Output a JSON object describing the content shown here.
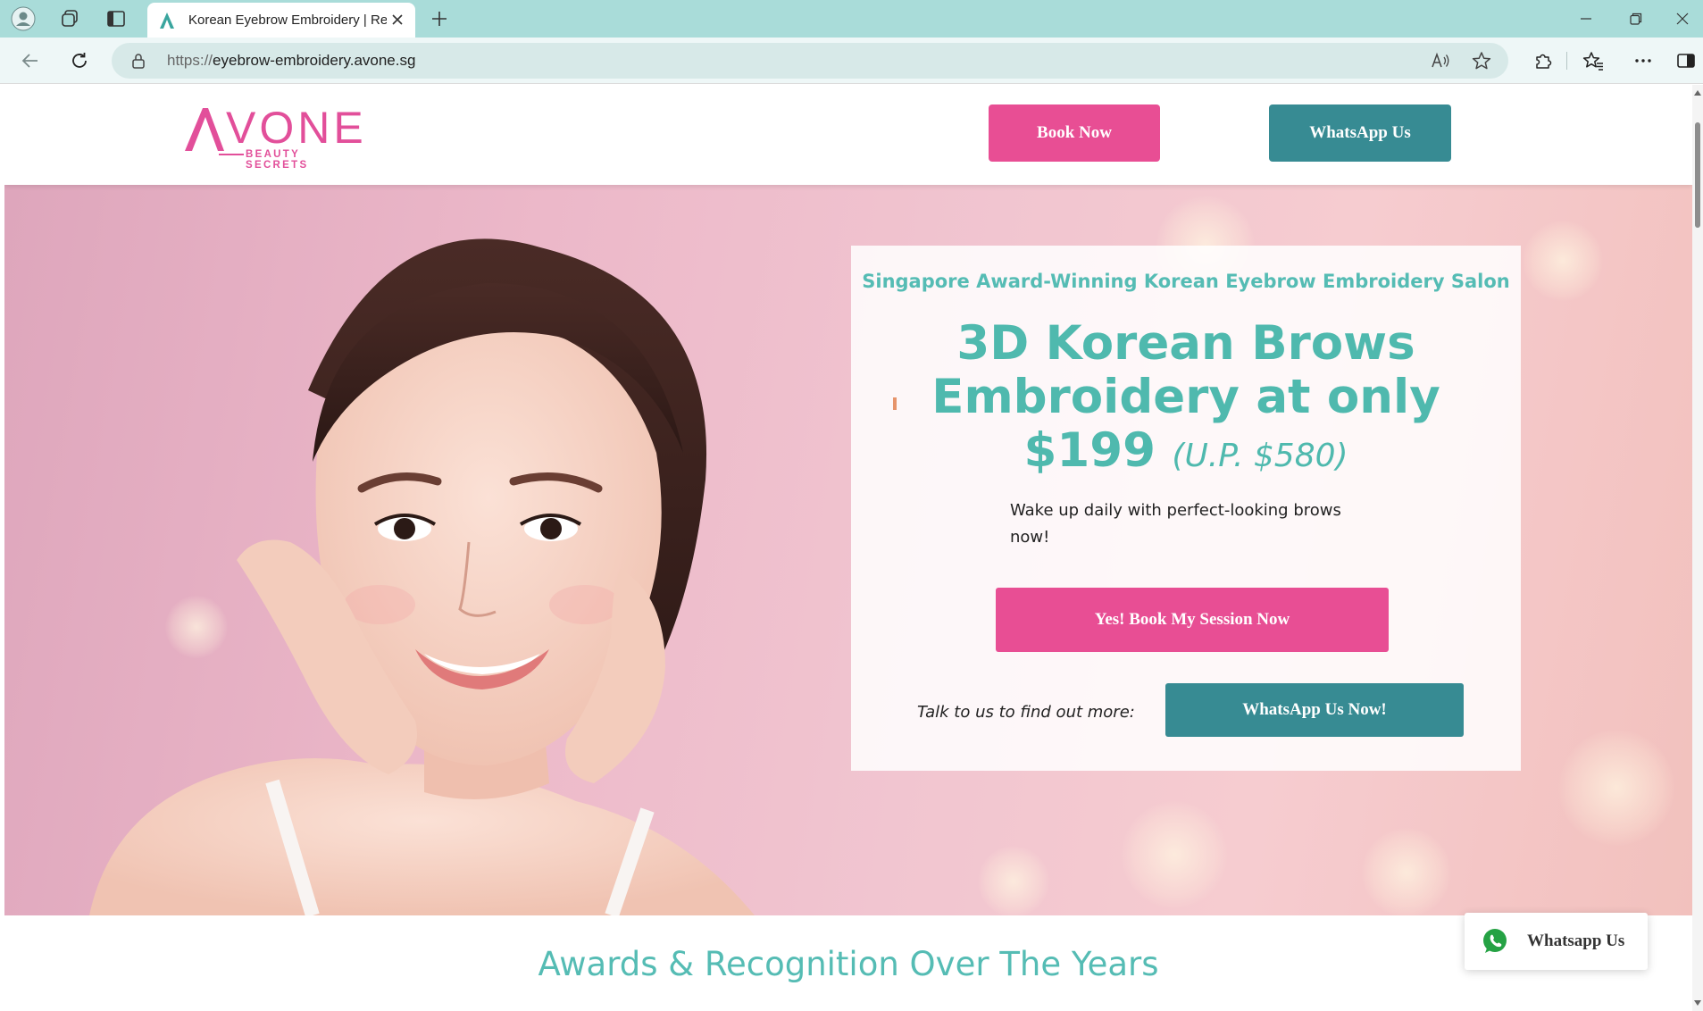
{
  "browser": {
    "tab_title": "Korean Eyebrow Embroidery | Red",
    "url_protocol": "https://",
    "url_host": "eyebrow-embroidery.avone.sg"
  },
  "header": {
    "logo_word": "VONE",
    "logo_tagline": "BEAUTY SECRETS",
    "book_now": "Book Now",
    "whatsapp": "WhatsApp Us"
  },
  "hero": {
    "kicker": "Singapore Award-Winning Korean Eyebrow Embroidery Salon",
    "title_line1": "3D Korean Brows",
    "title_line2": "Embroidery at only",
    "price": "$199",
    "usual_price": "(U.P. $580)",
    "subtitle": "Wake up daily with perfect-looking brows now!",
    "cta": "Yes! Book My Session Now",
    "talk_text": "Talk to us to find out more:",
    "whatsapp_cta": "WhatsApp Us Now!"
  },
  "awards": {
    "heading": "Awards & Recognition Over The Years"
  },
  "floating_whatsapp": {
    "label": "Whatsapp Us"
  },
  "colors": {
    "brand_pink": "#e84e94",
    "brand_teal": "#378b93",
    "heading_teal": "#4fb9ae",
    "chrome_tab_bar": "#a9dcd9"
  },
  "icons": {
    "profile": "profile-icon",
    "workspaces": "workspaces-icon",
    "tab_actions": "vertical-tabs-icon",
    "favicon": "avone-favicon-icon",
    "close_tab": "close-icon",
    "new_tab": "plus-icon",
    "back": "back-arrow-icon",
    "refresh": "refresh-icon",
    "lock": "lock-icon",
    "read_aloud": "read-aloud-icon",
    "favorite": "star-icon",
    "extensions": "puzzle-icon",
    "favorites_list": "favorites-icon",
    "more": "more-dots-icon",
    "sidebar": "sidebar-icon",
    "whatsapp": "whatsapp-icon"
  }
}
